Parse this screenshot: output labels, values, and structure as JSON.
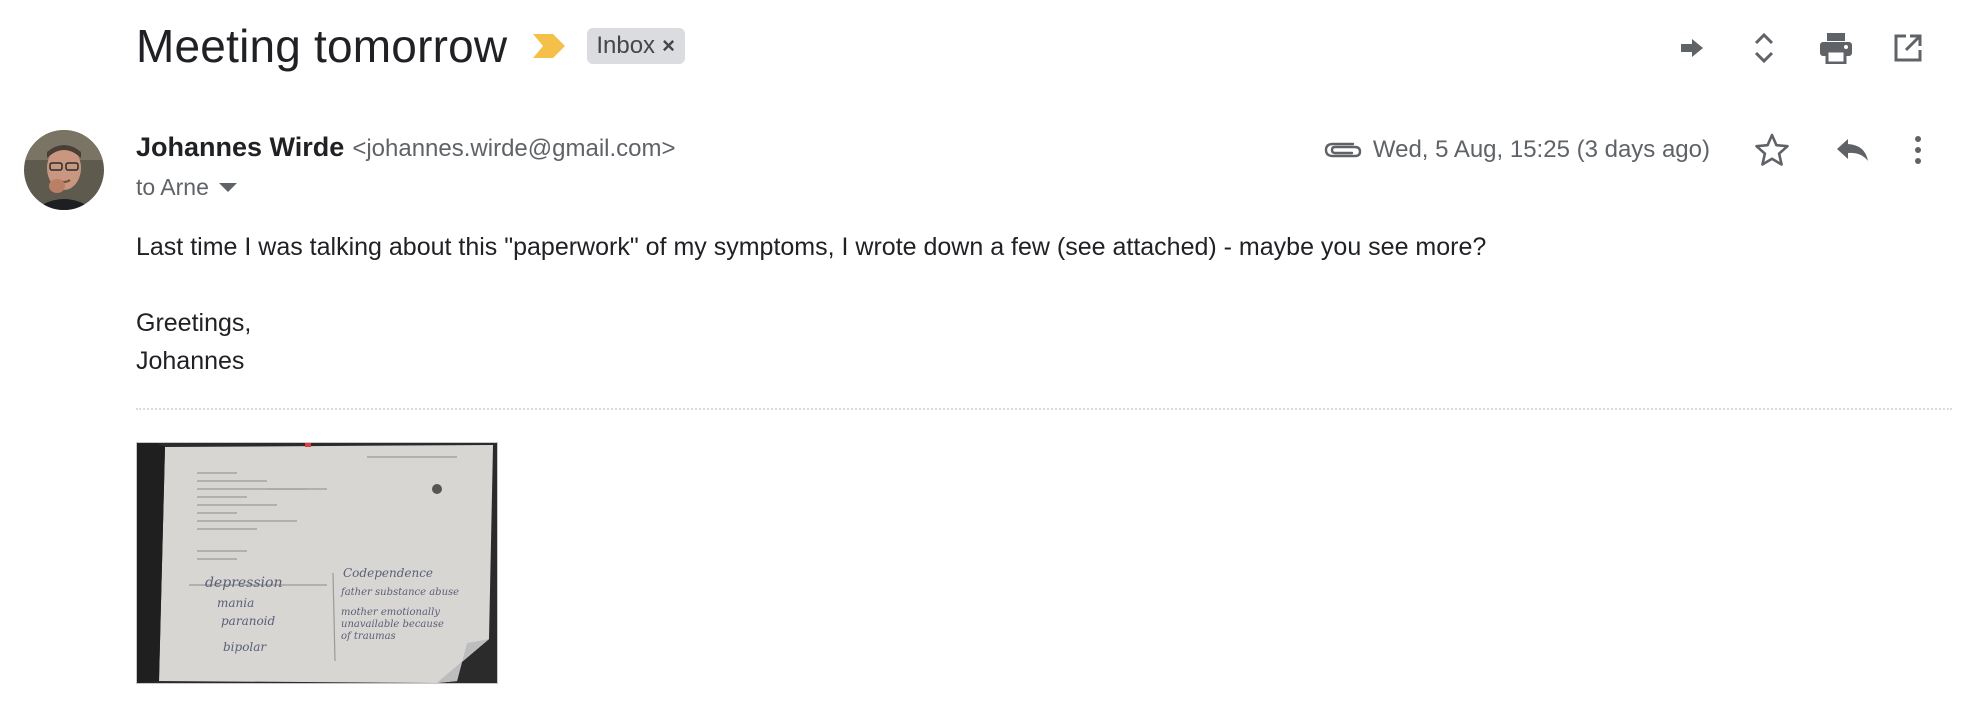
{
  "subject": "Meeting tomorrow",
  "label_chip": {
    "text": "Inbox",
    "remove_glyph": "×"
  },
  "top_icons": [
    "forward-arrow-icon",
    "expand-collapse-icon",
    "print-icon",
    "open-in-new-window-icon"
  ],
  "sender": {
    "name": "Johannes Wirde",
    "email": "<johannes.wirde@gmail.com>",
    "to_line": "to Arne"
  },
  "meta": {
    "date": "Wed, 5 Aug, 15:25 (3 days ago)",
    "icons": [
      "attachment-clip-icon",
      "star-icon",
      "reply-icon",
      "more-vert-icon"
    ]
  },
  "body": {
    "line1": "Last time I was talking about this \"paperwork\" of my symptoms, I wrote down a few (see attached) - maybe you see more?",
    "line2": "Greetings,",
    "line3": "Johannes"
  },
  "attachment": {
    "left_words": [
      "depression",
      "mania",
      "paranoid",
      "bipolar"
    ],
    "right_words": [
      "Codependence",
      "father substance abuse",
      "mother emotionally",
      "unavailable because",
      "of traumas"
    ]
  },
  "colors": {
    "importance_marker": "#f5c04a",
    "chip_bg": "#dadce0",
    "icon_gray": "#5f6368",
    "text": "#202124"
  }
}
